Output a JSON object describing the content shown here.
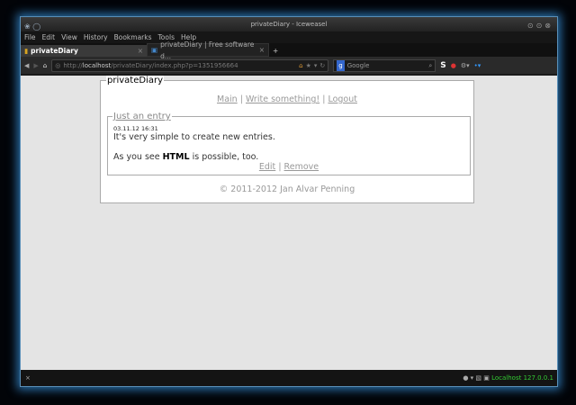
{
  "window": {
    "title": "privateDiary - Iceweasel"
  },
  "menu": [
    "File",
    "Edit",
    "View",
    "History",
    "Bookmarks",
    "Tools",
    "Help"
  ],
  "tabs": [
    {
      "label": "privateDiary"
    },
    {
      "label": "privateDiary | Free software d..."
    }
  ],
  "nav": {
    "url_prefix": "http://",
    "url_host": "localhost",
    "url_path": "/privateDiary/index.php?p=1351956664",
    "search_placeholder": "Google",
    "search_engine_letter": "g",
    "s_label": "S"
  },
  "page": {
    "title": "privateDiary",
    "links": [
      "Main",
      "Write something!",
      "Logout"
    ],
    "separator": "|",
    "entry": {
      "title": "Just an entry",
      "date": "03.11.12 16:31",
      "line1": "It's very simple to create new entries.",
      "line2_pre": "As you see ",
      "line2_bold": "HTML",
      "line2_post": " is possible, too.",
      "edit": "Edit",
      "remove": "Remove"
    },
    "footer": "© 2011-2012 Jan Alvar Penning"
  },
  "status": {
    "left": "×",
    "host": "Localhost",
    "ip": "127.0.0.1"
  }
}
